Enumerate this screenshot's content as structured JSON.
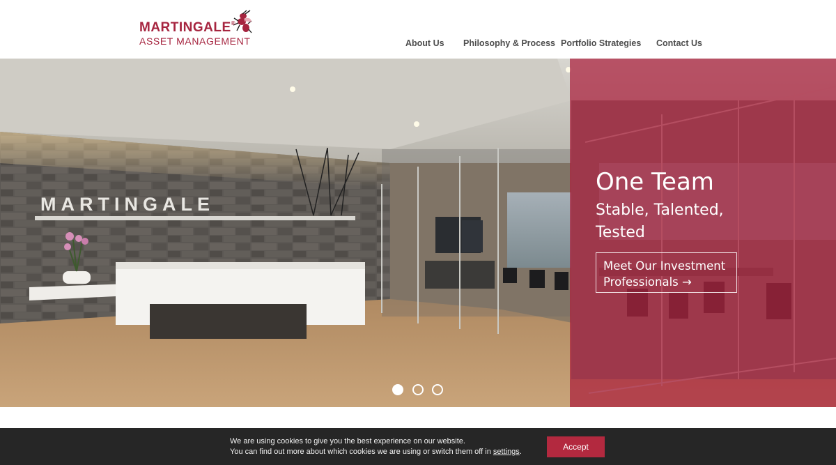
{
  "brand": {
    "name": "MARTINGALE",
    "registered": "®",
    "subtitle": "ASSET MANAGEMENT",
    "color": "#a6243f"
  },
  "nav": {
    "items": [
      {
        "label": "About Us"
      },
      {
        "label": "Philosophy & Process"
      },
      {
        "label": "Portfolio Strategies"
      },
      {
        "label": "Contact Us"
      }
    ]
  },
  "hero": {
    "wall_sign": "MARTINGALE",
    "title": "One Team",
    "subtitle": "Stable, Talented, Tested",
    "cta_label": "Meet Our Investment Professionals →",
    "overlay_color": "#aa1e3c",
    "slides": [
      {
        "active": true
      },
      {
        "active": false
      },
      {
        "active": false
      }
    ]
  },
  "cookie_notice": {
    "line1": "We are using cookies to give you the best experience on our website.",
    "line2_prefix": "You can find out more about which cookies we are using or switch them off in ",
    "line2_link": "settings",
    "line2_suffix": ".",
    "accept_label": "Accept",
    "accept_color": "#b3293f"
  }
}
